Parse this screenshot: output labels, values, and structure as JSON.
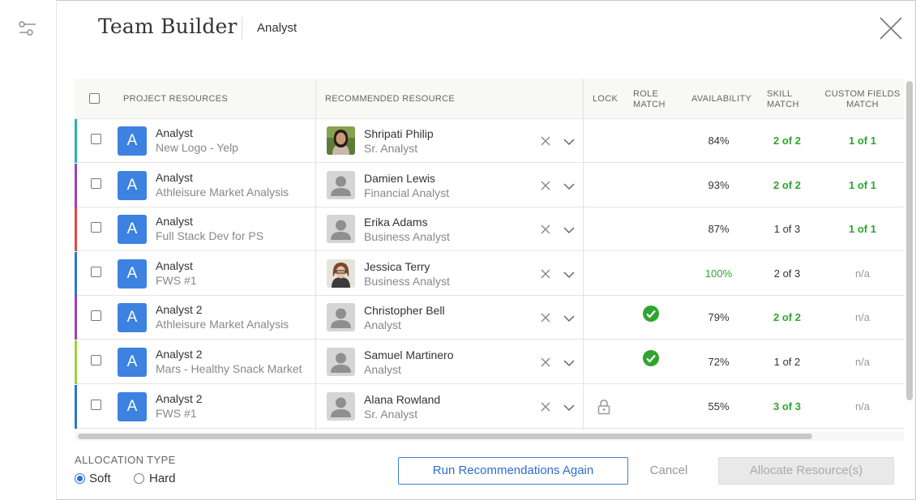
{
  "header": {
    "title": "Team Builder",
    "subtitle": "Analyst"
  },
  "table": {
    "columns": {
      "project_resources": "PROJECT RESOURCES",
      "recommended_resource": "RECOMMENDED RESOURCE",
      "lock": "LOCK",
      "role_match_1": "ROLE",
      "role_match_2": "MATCH",
      "availability": "AVAILABILITY",
      "skill_match_1": "SKILL",
      "skill_match_2": "MATCH",
      "custom_fields_1": "CUSTOM FIELDS",
      "custom_fields_2": "MATCH"
    },
    "rows": [
      {
        "project_role": "Analyst",
        "project_name": "New Logo - Yelp",
        "initial": "A",
        "stripe_color": "#2ab3b1",
        "resource_name": "Shripati Philip",
        "resource_title": "Sr. Analyst",
        "avatar": "photo-woman-1",
        "locked": false,
        "role_match": false,
        "availability": "84%",
        "skill_match": "2 of 2",
        "custom_match": "1 of 1"
      },
      {
        "project_role": "Analyst",
        "project_name": "Athleisure Market Analysis",
        "initial": "A",
        "stripe_color": "#a23fb6",
        "resource_name": "Damien Lewis",
        "resource_title": "Financial Analyst",
        "avatar": "placeholder",
        "locked": false,
        "role_match": false,
        "availability": "93%",
        "skill_match": "2 of 2",
        "custom_match": "1 of 1"
      },
      {
        "project_role": "Analyst",
        "project_name": "Full Stack Dev for PS",
        "initial": "A",
        "stripe_color": "#e5473d",
        "resource_name": "Erika Adams",
        "resource_title": "Business Analyst",
        "avatar": "placeholder",
        "locked": false,
        "role_match": false,
        "availability": "87%",
        "skill_match": "1 of 3",
        "custom_match": "1 of 1"
      },
      {
        "project_role": "Analyst",
        "project_name": "FWS #1",
        "initial": "A",
        "stripe_color": "#2f74d8",
        "resource_name": "Jessica Terry",
        "resource_title": "Business Analyst",
        "avatar": "photo-woman-2",
        "locked": false,
        "role_match": false,
        "availability": "100%",
        "skill_match": "2 of 3",
        "custom_match": "n/a"
      },
      {
        "project_role": "Analyst 2",
        "project_name": "Athleisure Market Analysis",
        "initial": "A",
        "stripe_color": "#a23fb6",
        "resource_name": "Christopher Bell",
        "resource_title": "Analyst",
        "avatar": "placeholder",
        "locked": false,
        "role_match": true,
        "availability": "79%",
        "skill_match": "2 of 2",
        "custom_match": "n/a"
      },
      {
        "project_role": "Analyst 2",
        "project_name": "Mars - Healthy Snack Market",
        "initial": "A",
        "stripe_color": "#9fd13a",
        "resource_name": "Samuel Martinero",
        "resource_title": "Analyst",
        "avatar": "placeholder",
        "locked": false,
        "role_match": true,
        "availability": "72%",
        "skill_match": "1 of 2",
        "custom_match": "n/a"
      },
      {
        "project_role": "Analyst 2",
        "project_name": "FWS #1",
        "initial": "A",
        "stripe_color": "#2f74d8",
        "resource_name": "Alana Rowland",
        "resource_title": "Sr. Analyst",
        "avatar": "placeholder",
        "locked": true,
        "role_match": false,
        "availability": "55%",
        "skill_match": "3 of 3",
        "custom_match": "n/a"
      }
    ]
  },
  "footer": {
    "allocation_type_label": "ALLOCATION TYPE",
    "soft_label": "Soft",
    "hard_label": "Hard",
    "selected": "Soft",
    "run_again_label": "Run Recommendations Again",
    "cancel_label": "Cancel",
    "allocate_label": "Allocate Resource(s)"
  },
  "colors": {
    "accent": "#3d82e0",
    "match_green": "#2fa52f"
  }
}
